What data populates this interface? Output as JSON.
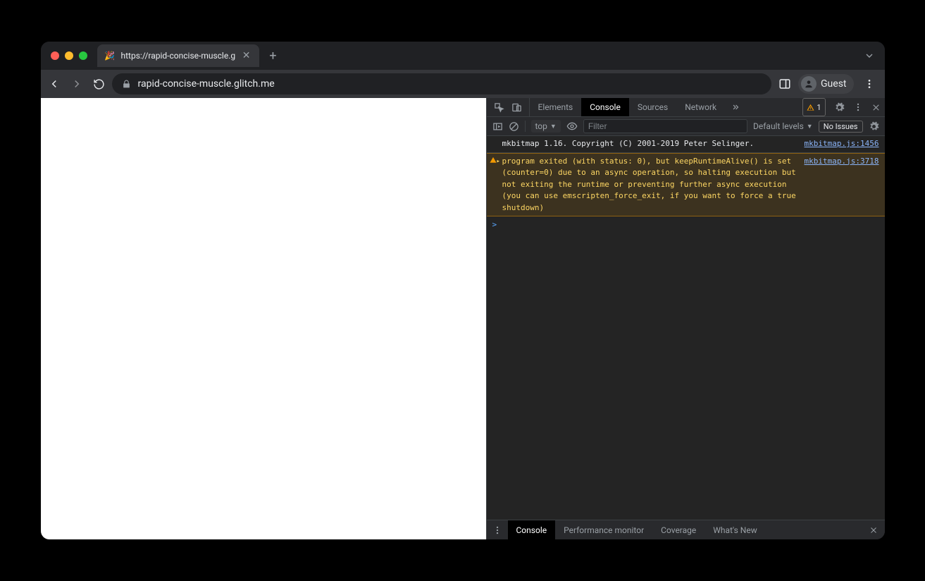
{
  "tab": {
    "title": "https://rapid-concise-muscle.g",
    "favicon": "🎉"
  },
  "toolbar": {
    "url": "rapid-concise-muscle.glitch.me",
    "guest_label": "Guest"
  },
  "devtools": {
    "tabs": [
      "Elements",
      "Console",
      "Sources",
      "Network"
    ],
    "active_tab": "Console",
    "warn_count": "1",
    "console": {
      "context": "top",
      "filter_placeholder": "Filter",
      "levels_label": "Default levels",
      "no_issues_label": "No Issues",
      "messages": [
        {
          "type": "info",
          "text": "mkbitmap 1.16. Copyright (C) 2001-2019 Peter Selinger.",
          "source": "mkbitmap.js:1456"
        },
        {
          "type": "warn",
          "text": "program exited (with status: 0), but keepRuntimeAlive() is set (counter=0) due to an async operation, so halting execution but not exiting the runtime or preventing further async execution (you can use emscripten_force_exit, if you want to force a true shutdown)",
          "source": "mkbitmap.js:3718"
        }
      ],
      "prompt": ">"
    },
    "drawer": {
      "tabs": [
        "Console",
        "Performance monitor",
        "Coverage",
        "What's New"
      ],
      "active": "Console"
    }
  }
}
